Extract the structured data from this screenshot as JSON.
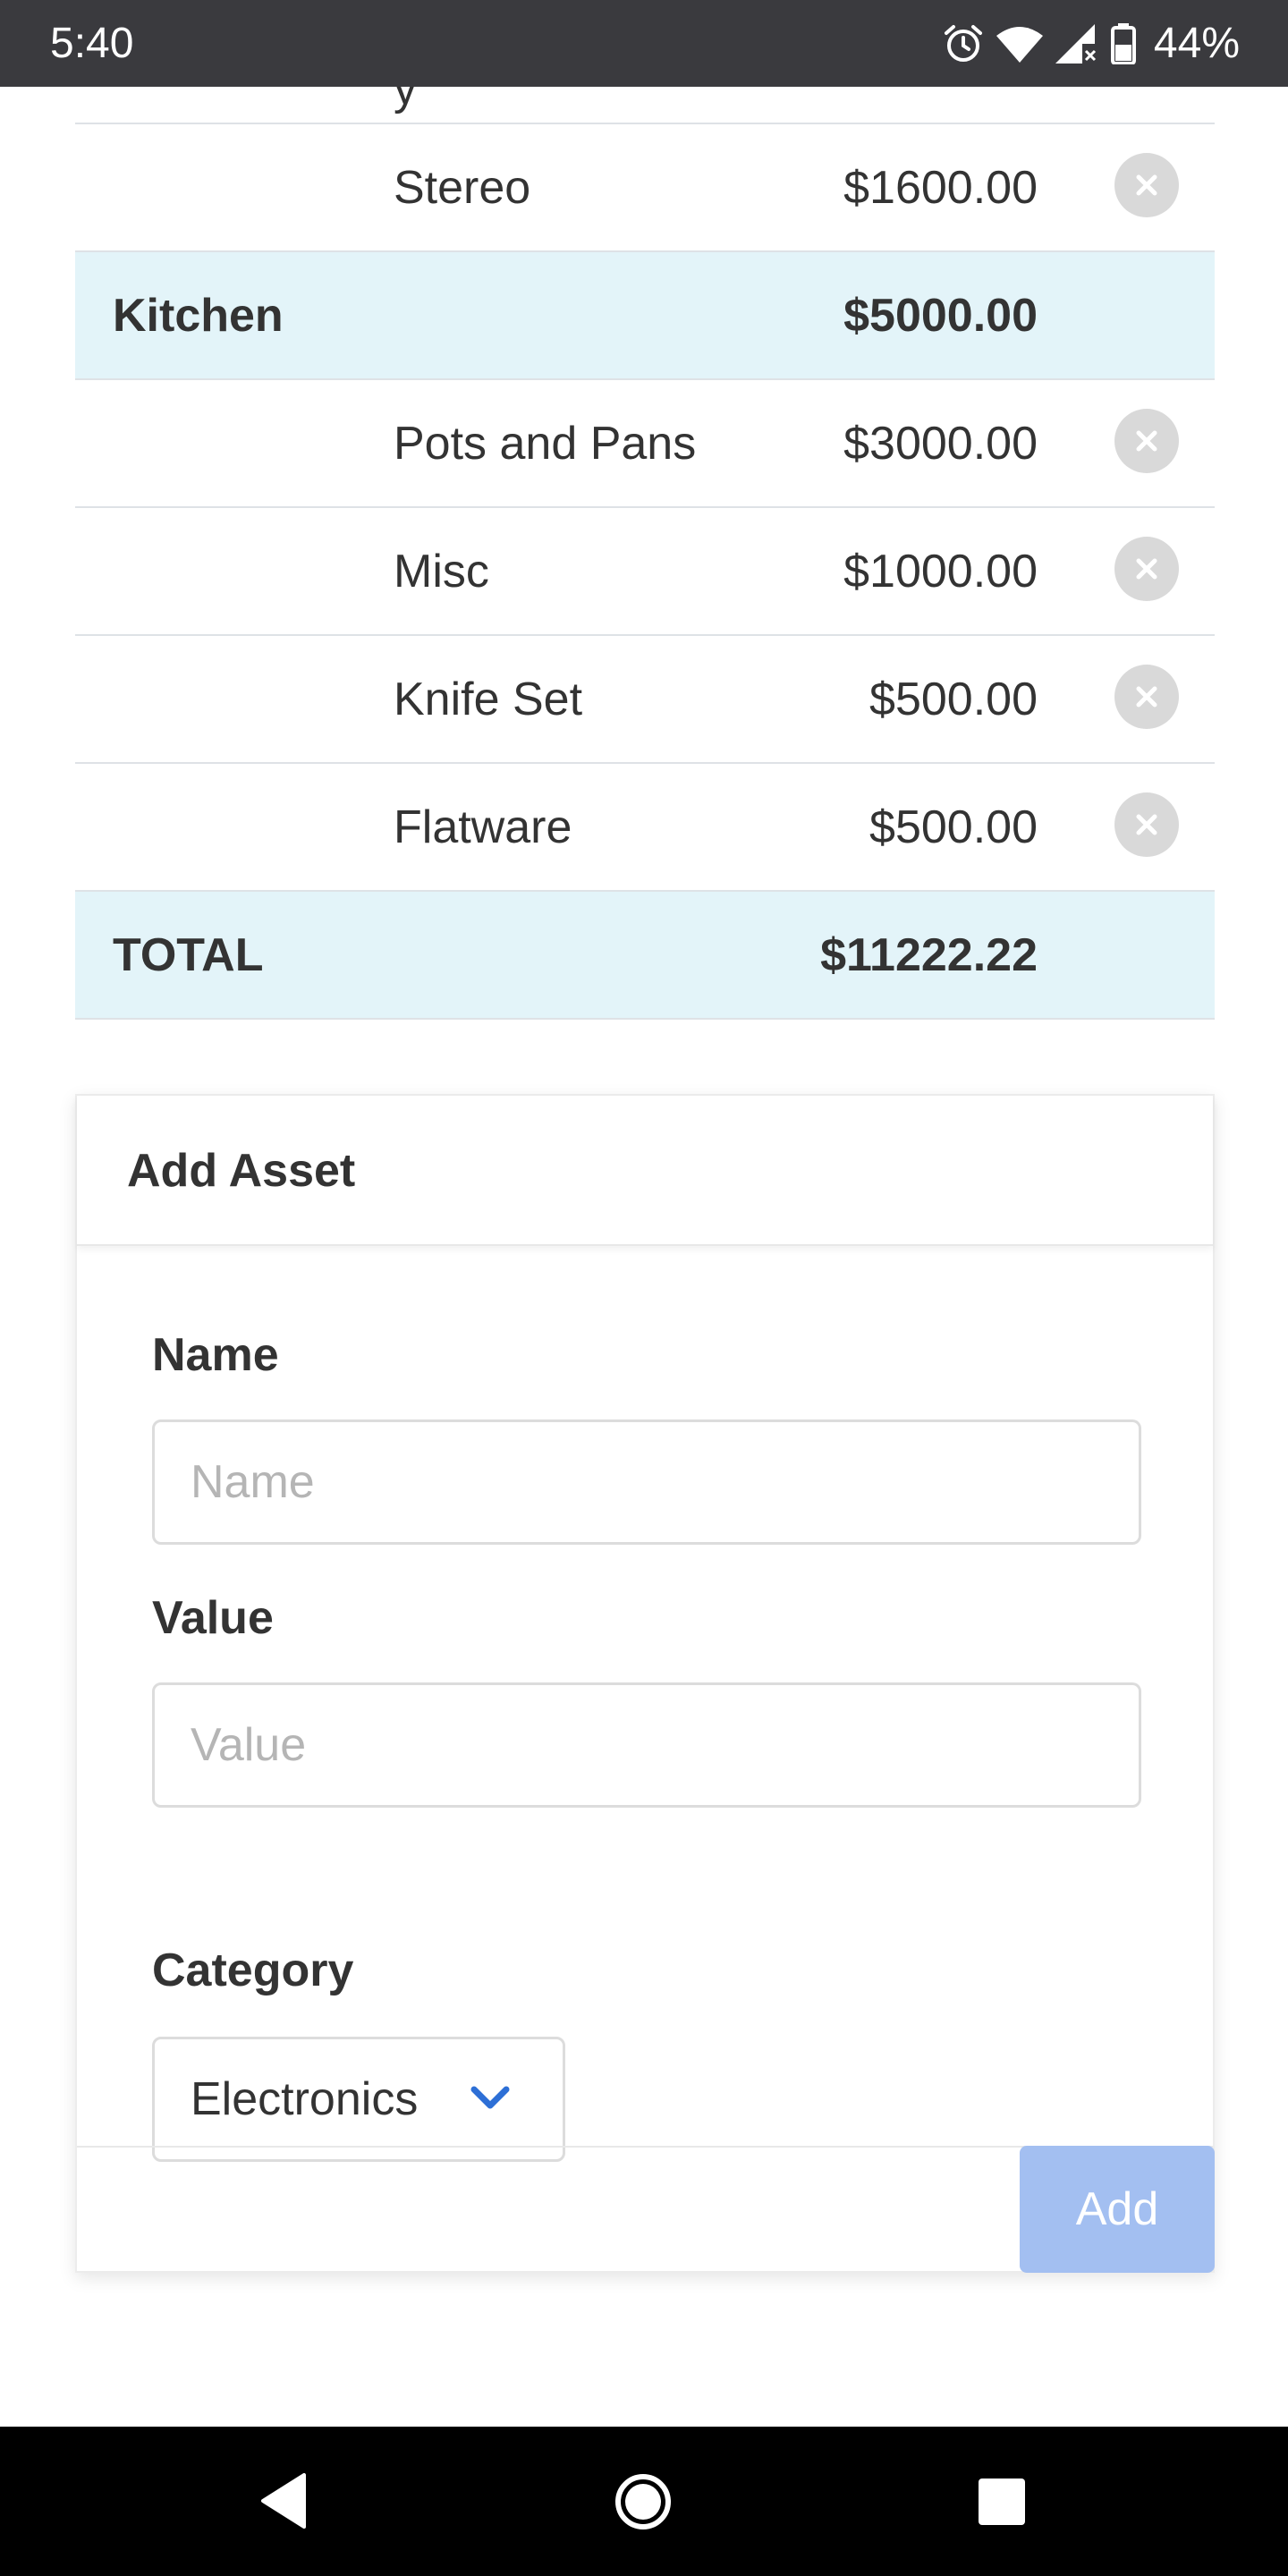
{
  "status_bar": {
    "time": "5:40",
    "battery": "44%",
    "icons": [
      "alarm-icon",
      "wifi-icon",
      "cell-signal-icon",
      "battery-icon"
    ]
  },
  "table": {
    "rows": [
      {
        "type": "item",
        "name": "Stereo",
        "value": "$1600.00"
      },
      {
        "type": "category",
        "name": "Kitchen",
        "value": "$5000.00"
      },
      {
        "type": "item",
        "name": "Pots and Pans",
        "value": "$3000.00"
      },
      {
        "type": "item",
        "name": "Misc",
        "value": "$1000.00"
      },
      {
        "type": "item",
        "name": "Knife Set",
        "value": "$500.00"
      },
      {
        "type": "item",
        "name": "Flatware",
        "value": "$500.00"
      }
    ],
    "total": {
      "label": "TOTAL",
      "value": "$11222.22"
    }
  },
  "add_asset": {
    "title": "Add Asset",
    "name_label": "Name",
    "name_placeholder": "Name",
    "name_value": "",
    "value_label": "Value",
    "value_placeholder": "Value",
    "value_value": "",
    "category_label": "Category",
    "category_selected": "Electronics",
    "add_label": "Add"
  },
  "colors": {
    "status_bar": "#3a3a3e",
    "highlight_row": "#e3f4f9",
    "add_button": "#a3bff1",
    "chevron": "#2d6fd6"
  }
}
